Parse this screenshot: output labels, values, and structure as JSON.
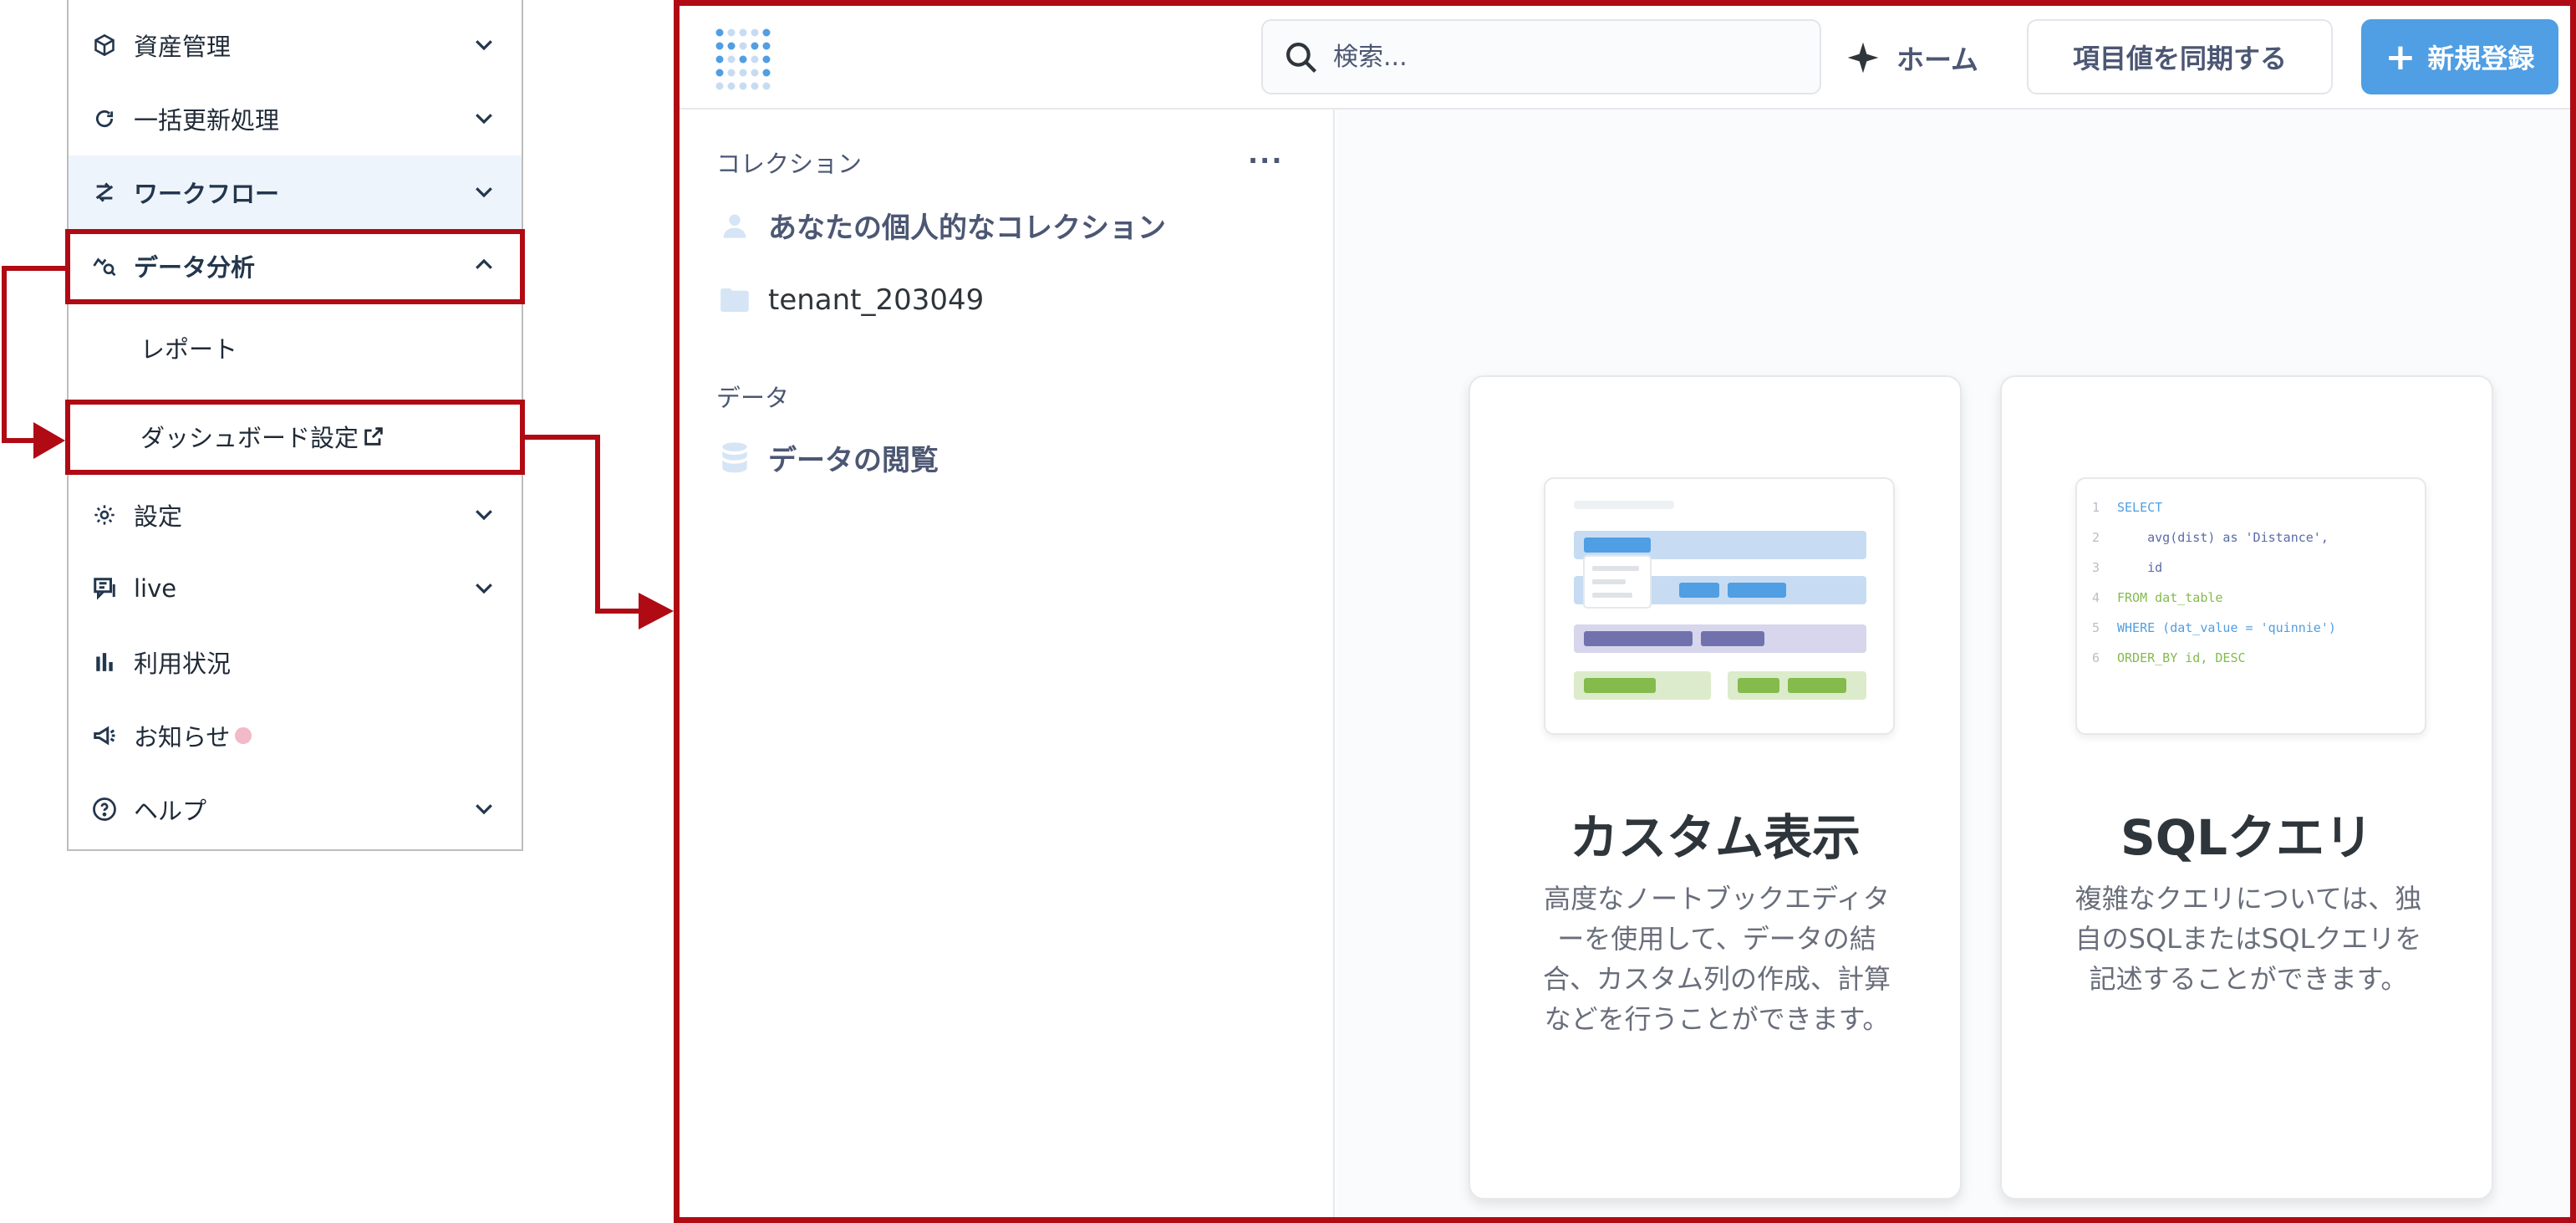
{
  "nav": {
    "items": [
      {
        "label": "資産管理"
      },
      {
        "label": "一括更新処理"
      },
      {
        "label": "ワークフロー"
      },
      {
        "label": "データ分析"
      },
      {
        "label": "設定"
      },
      {
        "label": "live"
      },
      {
        "label": "利用状況"
      },
      {
        "label": "お知らせ"
      },
      {
        "label": "ヘルプ"
      }
    ],
    "sub_items": [
      {
        "label": "レポート"
      },
      {
        "label": "ダッシュボード設定"
      }
    ]
  },
  "app": {
    "search": {
      "placeholder": "検索..."
    },
    "home_label": "ホーム",
    "sync_label": "項目値を同期する",
    "new_label": "新規登録",
    "collections": {
      "section_label": "コレクション",
      "more": "···",
      "items": [
        {
          "label": "あなたの個人的なコレクション"
        },
        {
          "label": "tenant_203049"
        }
      ]
    },
    "data_section": {
      "label": "データ",
      "items": [
        {
          "label": "データの閲覧"
        }
      ]
    },
    "cards": [
      {
        "title": "カスタム表示",
        "description": "高度なノートブックエディターを使用して、データの結合、カスタム列の作成、計算などを行うことができます。"
      },
      {
        "title": "SQLクエリ",
        "description": "複雑なクエリについては、独自のSQLまたはSQLクエリを記述することができます。",
        "code_lines": [
          "SELECT",
          "avg(dist) as 'Distance',",
          "id",
          "FROM dat_table",
          "WHERE (dat_value = 'quinnie')",
          "ORDER_BY id, DESC"
        ]
      }
    ]
  },
  "colors": {
    "highlight_red": "#b00a14",
    "brand_blue": "#509ee3",
    "nav_text": "#23364d",
    "notification_dot": "#f2b9c9"
  }
}
